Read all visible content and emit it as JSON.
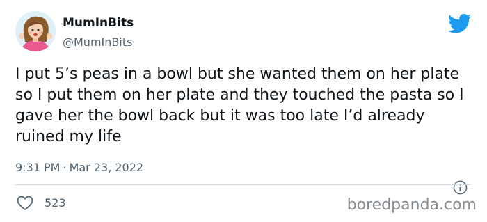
{
  "author": {
    "display_name": "MumInBits",
    "handle": "@MumInBits",
    "avatar_icon": "cartoon-woman-avatar"
  },
  "tweet": {
    "text": "I put 5’s peas in a bowl but she wanted them on her plate so I put them on her plate and they touched the pasta so I gave her the bowl back but it was too late I’d already ruined my life"
  },
  "meta": {
    "time": "9:31 PM",
    "separator": "·",
    "date": "Mar 23, 2022"
  },
  "actions": {
    "like_count": "523"
  },
  "watermark": "boredpanda.com",
  "icons": {
    "brand": "twitter-bird-icon",
    "info": "info-icon",
    "like": "heart-icon"
  },
  "colors": {
    "twitter_blue": "#1d9bf0",
    "secondary_text": "#536471",
    "divider": "#cfd9de"
  }
}
